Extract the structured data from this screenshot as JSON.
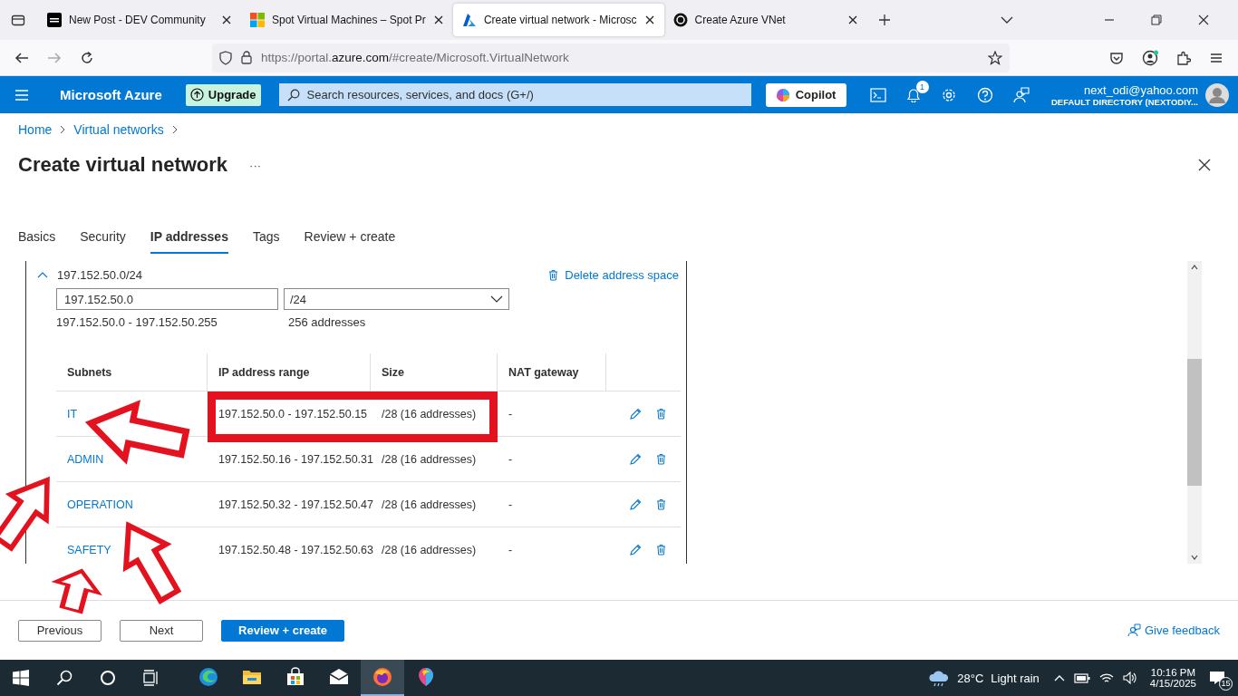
{
  "browser": {
    "tabs": [
      {
        "title": "New Post - DEV Community",
        "kind": "dev",
        "selected": false
      },
      {
        "title": "Spot Virtual Machines – Spot Pr",
        "kind": "windows",
        "selected": false
      },
      {
        "title": "Create virtual network - Microsc",
        "kind": "azure",
        "selected": true
      },
      {
        "title": "Create Azure VNet",
        "kind": "chat",
        "selected": false
      }
    ],
    "url_prefix": "https://portal.",
    "url_domain": "azure.com",
    "url_rest": "/#create/Microsoft.VirtualNetwork"
  },
  "portal": {
    "brand": "Microsoft Azure",
    "upgrade": "Upgrade",
    "search_placeholder": "Search resources, services, and docs (G+/)",
    "copilot": "Copilot",
    "notification_count": "1",
    "account": "next_odi@yahoo.com",
    "directory": "DEFAULT DIRECTORY (NEXTODIY..."
  },
  "breadcrumb": [
    "Home",
    "Virtual networks"
  ],
  "title": "Create virtual network",
  "more": "···",
  "tabs": [
    {
      "label": "Basics",
      "selected": false
    },
    {
      "label": "Security",
      "selected": false
    },
    {
      "label": "IP addresses",
      "selected": true
    },
    {
      "label": "Tags",
      "selected": false
    },
    {
      "label": "Review + create",
      "selected": false
    }
  ],
  "address_space": {
    "name": "197.152.50.0/24",
    "expanded": true,
    "delete": "Delete address space",
    "address": "197.152.50.0",
    "prefix": "/24",
    "range": "197.152.50.0 - 197.152.50.255",
    "count": "256 addresses"
  },
  "subnets": {
    "columns": [
      "Subnets",
      "IP address range",
      "Size",
      "NAT gateway"
    ],
    "rows": [
      {
        "name": "IT",
        "range": "197.152.50.0 - 197.152.50.15",
        "size": "/28 (16 addresses)",
        "nat": "-",
        "highlighted": true
      },
      {
        "name": "ADMIN",
        "range": "197.152.50.16 - 197.152.50.31",
        "size": "/28 (16 addresses)",
        "nat": "-",
        "highlighted": false
      },
      {
        "name": "OPERATION",
        "range": "197.152.50.32 - 197.152.50.47",
        "size": "/28 (16 addresses)",
        "nat": "-",
        "highlighted": false
      },
      {
        "name": "SAFETY",
        "range": "197.152.50.48 - 197.152.50.63",
        "size": "/28 (16 addresses)",
        "nat": "-",
        "highlighted": false
      }
    ]
  },
  "footer": {
    "buttons": [
      {
        "label": "Previous",
        "kind": "secondary"
      },
      {
        "label": "Next",
        "kind": "secondary"
      },
      {
        "label": "Review + create",
        "kind": "primary"
      }
    ],
    "feedback": "Give feedback"
  },
  "taskbar": {
    "apps": [
      {
        "kind": "edge",
        "active": false
      },
      {
        "kind": "folder",
        "active": false
      },
      {
        "kind": "store",
        "active": false
      },
      {
        "kind": "mail",
        "active": false
      },
      {
        "kind": "firefox",
        "active": true
      },
      {
        "kind": "paint",
        "active": false
      }
    ],
    "temperature": "28°C",
    "weather": "Light rain",
    "time": "10:16 PM",
    "date": "4/15/2025",
    "notifications": "15"
  }
}
